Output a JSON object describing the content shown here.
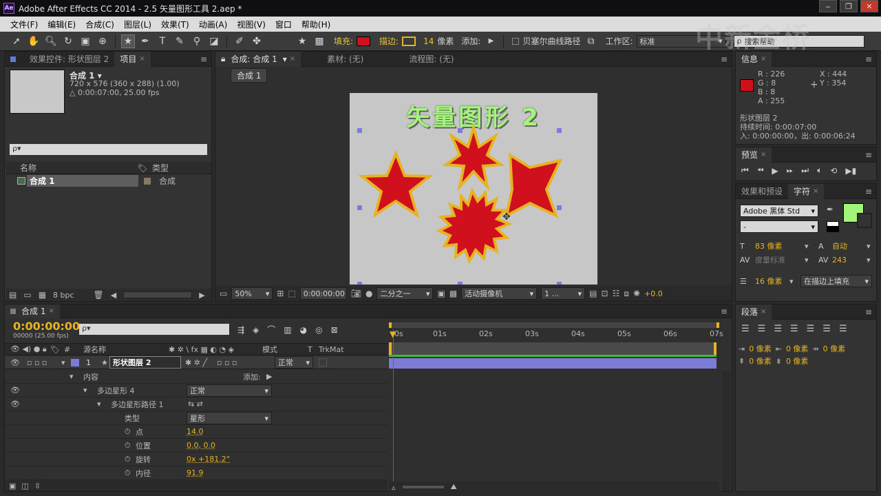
{
  "window": {
    "title": "Adobe After Effects CC 2014 - 2.5 矢量图形工具 2.aep *",
    "app_icon": "Ae",
    "controls": [
      "‒",
      "❐",
      "✕"
    ]
  },
  "watermark": "中新金桥",
  "menubar": [
    "文件(F)",
    "编辑(E)",
    "合成(C)",
    "图层(L)",
    "效果(T)",
    "动画(A)",
    "视图(V)",
    "窗口",
    "帮助(H)"
  ],
  "toolbar": {
    "fill_label": "填充:",
    "fill_color": "#d0101c",
    "stroke_label": "描边:",
    "stroke_color": "#e6b422",
    "stroke_width": "14",
    "stroke_unit": "像素",
    "add_label": "添加:",
    "bezier_label": "贝塞尔曲线路径",
    "workspace_label": "工作区:",
    "workspace_value": "标准",
    "search_placeholder": "搜索帮助"
  },
  "project_panel": {
    "tab_effects": "效果控件: 形状图层 2",
    "tab_project": "项目",
    "comp_name": "合成 1 ▾",
    "comp_info1": "720 x 576  (360 x 288) (1.00)",
    "comp_info2": "△ 0:00:07:00, 25.00 fps",
    "search_placeholder": "ρ▾",
    "col_name": "名称",
    "col_type": "类型",
    "item_name": "合成 1",
    "item_type": "合成",
    "bpc": "8 bpc"
  },
  "comp_panel": {
    "tab_comp": "合成: 合成 1",
    "tab_footage": "素材: (无)",
    "tab_flow": "流程图: (无)",
    "subtab": "合成 1",
    "canvas_title": "矢量图形 2",
    "zoom": "50%",
    "time": "0:00:00:00",
    "resolution": "二分之一",
    "camera": "活动摄像机",
    "views": "1 ...",
    "exposure": "+0.0"
  },
  "info_panel": {
    "tab": "信息",
    "r": "R : 226",
    "g": "G : 8",
    "b": "B : 8",
    "a": "A : 255",
    "x": "X : 444",
    "y": "Y : 354",
    "color": "#d0101c",
    "layer": "形状图层 2",
    "duration": "持续时间: 0:00:07:00",
    "inout": "入: 0:00:00:00，出: 0:00:06:24"
  },
  "preview_panel": {
    "tab": "预览"
  },
  "char_panel": {
    "tab_effects": "效果和预设",
    "tab_char": "字符",
    "font": "Adobe 黑体 Std",
    "style": "-",
    "fill_color": "#a3f57a",
    "size": "83 像素",
    "leading": "自动",
    "kerning": "度量标准",
    "tracking": "243",
    "stroke_w": "16 像素",
    "stroke_mode": "在描边上填充"
  },
  "para_panel": {
    "tab": "段落",
    "indent1": "0 像素",
    "indent2": "0 像素",
    "indent3": "0 像素",
    "space1": "0 像素",
    "space2": "0 像素"
  },
  "timeline": {
    "tab": "合成 1",
    "timecode": "0:00:00:00",
    "fps": "00000 (25.00 fps)",
    "search_placeholder": "ρ▾",
    "col_source": "源名称",
    "col_mode": "模式",
    "col_t": "T",
    "col_trkmat": "TrkMat",
    "ruler": [
      "0s",
      "01s",
      "02s",
      "03s",
      "04s",
      "05s",
      "06s",
      "07s"
    ],
    "layer_num": "1",
    "layer_name": "形状图层 2",
    "layer_mode": "正常",
    "rows": [
      {
        "indent": 1,
        "label": "内容",
        "right_label": "添加:",
        "value": ""
      },
      {
        "indent": 2,
        "label": "多边星形 4",
        "value": "正常",
        "dropdown": true
      },
      {
        "indent": 3,
        "label": "多边星形路径 1",
        "value": ""
      },
      {
        "indent": 4,
        "label": "类型",
        "value": "星形",
        "dropdown": true
      },
      {
        "indent": 4,
        "label": "点",
        "value": "14.0",
        "stopwatch": true
      },
      {
        "indent": 4,
        "label": "位置",
        "value": "0.0, 0.0",
        "stopwatch": true
      },
      {
        "indent": 4,
        "label": "旋转",
        "value": "0x +181.2°",
        "stopwatch": true
      },
      {
        "indent": 4,
        "label": "内径",
        "value": "91.9",
        "stopwatch": true
      }
    ]
  }
}
